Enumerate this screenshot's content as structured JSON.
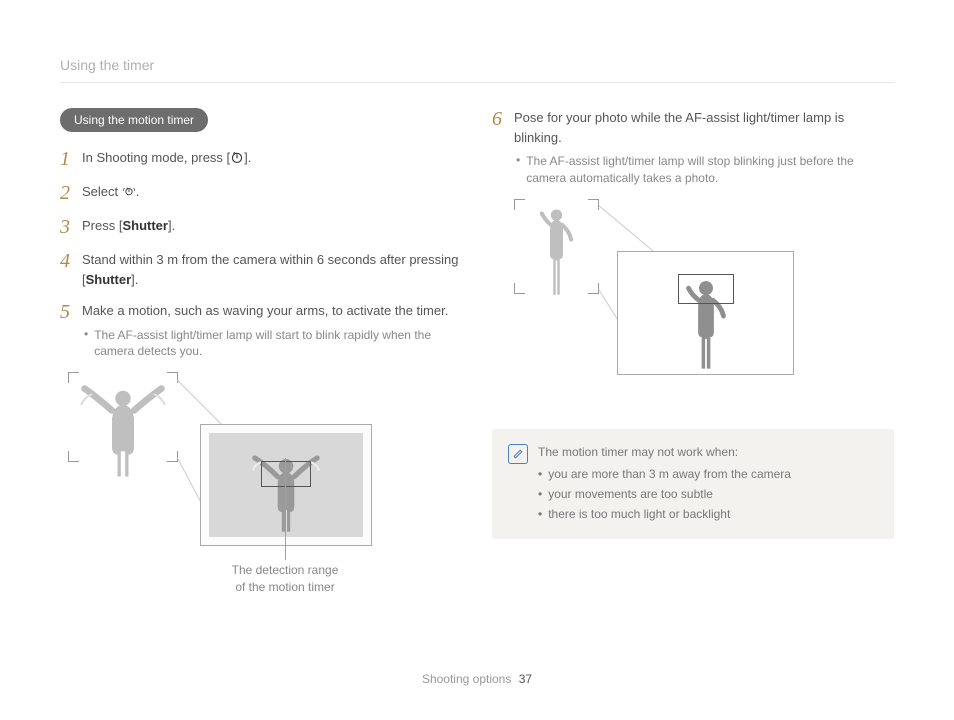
{
  "header": {
    "title": "Using the timer"
  },
  "pill": {
    "label": "Using the motion timer"
  },
  "icons": {
    "timer": "timer-icon",
    "motion": "motion-timer-icon"
  },
  "steps": {
    "s1": {
      "num": "1",
      "pre": "In Shooting mode, press [",
      "post": "]."
    },
    "s2": {
      "num": "2",
      "pre": "Select ",
      "post": "."
    },
    "s3": {
      "num": "3",
      "pre": "Press [",
      "bold": "Shutter",
      "post": "]."
    },
    "s4": {
      "num": "4",
      "pre": "Stand within 3 m from the camera within 6 seconds after pressing [",
      "bold": "Shutter",
      "post": "]."
    },
    "s5": {
      "num": "5",
      "text": "Make a motion, such as waving your arms, to activate the timer.",
      "bullet": "The AF-assist light/timer lamp will start to blink rapidly when the camera detects you."
    },
    "s6": {
      "num": "6",
      "text": "Pose for your photo while the AF-assist light/timer lamp is blinking.",
      "bullet": "The AF-assist light/timer lamp will stop blinking just before the camera automatically takes a photo."
    }
  },
  "caption": {
    "line1": "The detection range",
    "line2": "of the motion timer"
  },
  "note": {
    "lead": "The motion timer may not work when:",
    "items": [
      "you are more than 3 m away from the camera",
      "your movements are too subtle",
      "there is too much light or backlight"
    ]
  },
  "footer": {
    "section": "Shooting options",
    "page": "37"
  }
}
